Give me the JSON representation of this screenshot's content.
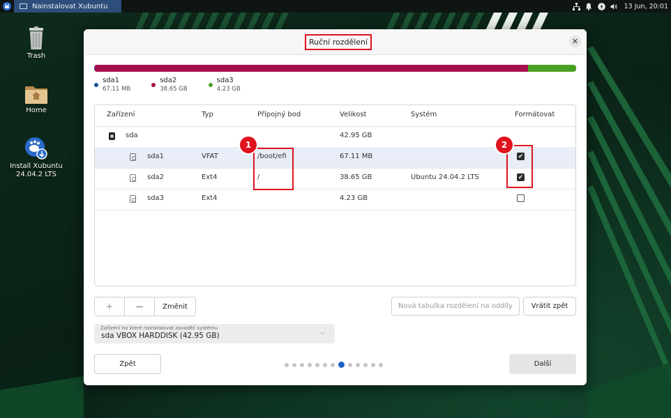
{
  "panel": {
    "task_title": "Nainstalovat Xubuntu",
    "clock": "13 Jun, 20:01",
    "tray_icons": [
      "network-icon",
      "bell-icon",
      "power-icon",
      "volume-icon"
    ]
  },
  "desktop": {
    "icons": [
      {
        "label": "Trash",
        "icon": "trash-icon"
      },
      {
        "label": "Home",
        "icon": "home-folder-icon"
      },
      {
        "label": "Install Xubuntu 24.04.2 LTS",
        "icon": "installer-icon"
      }
    ]
  },
  "dialog": {
    "title": "Ruční rozdělení",
    "close_icon": "close-icon",
    "usage": {
      "segments": [
        {
          "name": "sda1",
          "size": "67.11 MB",
          "color": "#1b4fa3",
          "fraction": 0.002
        },
        {
          "name": "sda2",
          "size": "38.65 GB",
          "color": "#a50e4c",
          "fraction": 0.898
        },
        {
          "name": "sda3",
          "size": "4.23 GB",
          "color": "#4aa020",
          "fraction": 0.1
        }
      ]
    },
    "table": {
      "headers": {
        "device": "Zařízení",
        "type": "Typ",
        "mount": "Přípojný bod",
        "size": "Velikost",
        "system": "Systém",
        "format": "Formátovat"
      },
      "rows": [
        {
          "device": "sda",
          "type": "",
          "mount": "",
          "size": "42.95 GB",
          "system": "",
          "format": null,
          "kind": "disk"
        },
        {
          "device": "sda1",
          "type": "VFAT",
          "mount": "/boot/efi",
          "size": "67.11 MB",
          "system": "",
          "format": true,
          "kind": "partition",
          "selected": true
        },
        {
          "device": "sda2",
          "type": "Ext4",
          "mount": "/",
          "size": "38.65 GB",
          "system": "Ubuntu 24.04.2 LTS",
          "format": true,
          "kind": "partition"
        },
        {
          "device": "sda3",
          "type": "Ext4",
          "mount": "",
          "size": "4.23 GB",
          "system": "",
          "format": false,
          "kind": "partition"
        }
      ]
    },
    "annotations": {
      "badge1": "1",
      "badge2": "2"
    },
    "toolbar": {
      "add": "+",
      "remove": "—",
      "change": "Změnit",
      "new_table": "Nová tabulka rozdělení na oddíly",
      "revert": "Vrátit zpět"
    },
    "bootloader": {
      "caption": "Zařízení na které nainstalovat zavaděč systému",
      "value": "sda VBOX HARDDISK (42.95 GB)"
    },
    "nav": {
      "back": "Zpět",
      "next": "Další",
      "steps_total": 13,
      "step_current": 8
    }
  }
}
